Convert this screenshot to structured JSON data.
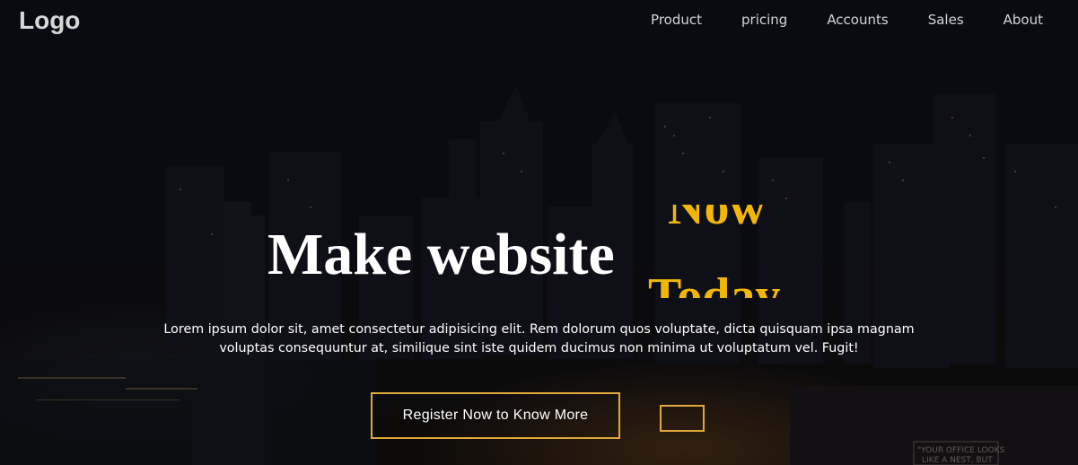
{
  "navbar": {
    "logo": "Logo",
    "links": [
      "Product",
      "pricing",
      "Accounts",
      "Sales",
      "About"
    ]
  },
  "hero": {
    "headline": "Make website",
    "rotating_words": [
      "Now",
      "Today"
    ],
    "description": "Lorem ipsum dolor sit, amet consectetur adipisicing elit. Rem dolorum quos voluptate, dicta quisquam ipsa magnam voluptas consequuntur at, similique sint iste quidem ducimus non minima ut voluptatum vel. Fugit!",
    "register_button": "Register Now to Know More",
    "secondary_button": ""
  },
  "colors": {
    "accent": "#f2b705",
    "button_border": "#e0a93a",
    "text": "#ffffff",
    "nav_text": "#d4d4d4"
  },
  "background": {
    "description_icon": "city-skyline-night"
  }
}
